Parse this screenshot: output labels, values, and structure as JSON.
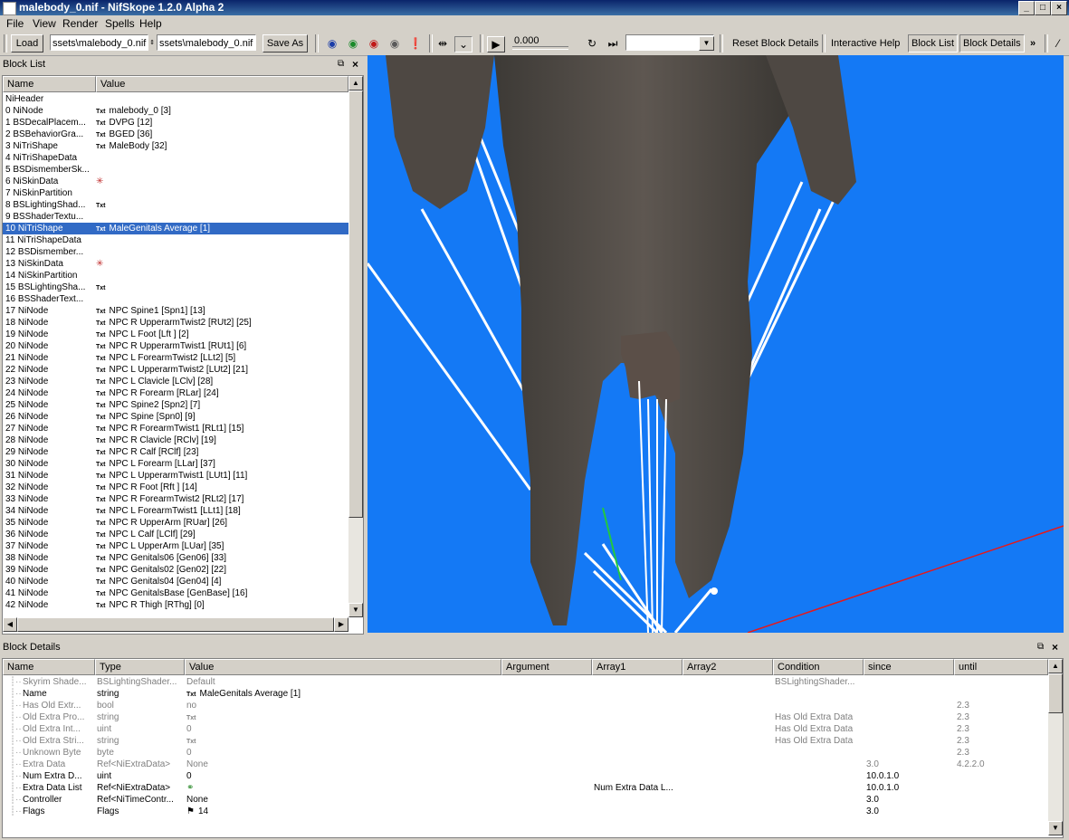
{
  "window": {
    "title": "malebody_0.nif - NifSkope 1.2.0 Alpha 2"
  },
  "menu": [
    "File",
    "View",
    "Render",
    "Spells",
    "Help"
  ],
  "toolbar": {
    "load_label": "Load",
    "load_path": "ssets\\malebody_0.nif",
    "save_path": "ssets\\malebody_0.nif",
    "save_as_label": "Save As",
    "time_value": "0.000",
    "reset_block_details": "Reset Block Details",
    "interactive_help": "Interactive Help",
    "block_list_tab": "Block List",
    "block_details_tab": "Block Details",
    "overflow": "»"
  },
  "block_list": {
    "title": "Block List",
    "columns": [
      "Name",
      "Value"
    ],
    "rows": [
      {
        "name": "NiHeader",
        "value": "",
        "icon": ""
      },
      {
        "name": "0 NiNode",
        "value": "malebody_0 [3]",
        "icon": "txt"
      },
      {
        "name": "1 BSDecalPlacem...",
        "value": "DVPG [12]",
        "icon": "txt"
      },
      {
        "name": "2 BSBehaviorGra...",
        "value": "BGED [36]",
        "icon": "txt"
      },
      {
        "name": "3 NiTriShape",
        "value": "MaleBody [32]",
        "icon": "txt"
      },
      {
        "name": "4 NiTriShapeData",
        "value": "",
        "icon": ""
      },
      {
        "name": "5 BSDismemberSk...",
        "value": "",
        "icon": ""
      },
      {
        "name": "6 NiSkinData",
        "value": "",
        "icon": "axes"
      },
      {
        "name": "7 NiSkinPartition",
        "value": "",
        "icon": ""
      },
      {
        "name": "8 BSLightingShad...",
        "value": "",
        "icon": "txt"
      },
      {
        "name": "9 BSShaderTextu...",
        "value": "",
        "icon": ""
      },
      {
        "name": "10 NiTriShape",
        "value": "MaleGenitals Average [1]",
        "icon": "txt",
        "selected": true
      },
      {
        "name": "11 NiTriShapeData",
        "value": "",
        "icon": ""
      },
      {
        "name": "12 BSDismember...",
        "value": "",
        "icon": ""
      },
      {
        "name": "13 NiSkinData",
        "value": "",
        "icon": "axes"
      },
      {
        "name": "14 NiSkinPartition",
        "value": "",
        "icon": ""
      },
      {
        "name": "15 BSLightingSha...",
        "value": "",
        "icon": "txt"
      },
      {
        "name": "16 BSShaderText...",
        "value": "",
        "icon": ""
      },
      {
        "name": "17 NiNode",
        "value": "NPC Spine1 [Spn1] [13]",
        "icon": "txt"
      },
      {
        "name": "18 NiNode",
        "value": "NPC R UpperarmTwist2 [RUt2] [25]",
        "icon": "txt"
      },
      {
        "name": "19 NiNode",
        "value": "NPC L Foot [Lft ] [2]",
        "icon": "txt"
      },
      {
        "name": "20 NiNode",
        "value": "NPC R UpperarmTwist1 [RUt1] [6]",
        "icon": "txt"
      },
      {
        "name": "21 NiNode",
        "value": "NPC L ForearmTwist2 [LLt2] [5]",
        "icon": "txt"
      },
      {
        "name": "22 NiNode",
        "value": "NPC L UpperarmTwist2 [LUt2] [21]",
        "icon": "txt"
      },
      {
        "name": "23 NiNode",
        "value": "NPC L Clavicle [LClv] [28]",
        "icon": "txt"
      },
      {
        "name": "24 NiNode",
        "value": "NPC R Forearm [RLar] [24]",
        "icon": "txt"
      },
      {
        "name": "25 NiNode",
        "value": "NPC Spine2 [Spn2] [7]",
        "icon": "txt"
      },
      {
        "name": "26 NiNode",
        "value": "NPC Spine [Spn0] [9]",
        "icon": "txt"
      },
      {
        "name": "27 NiNode",
        "value": "NPC R ForearmTwist1 [RLt1] [15]",
        "icon": "txt"
      },
      {
        "name": "28 NiNode",
        "value": "NPC R Clavicle [RClv] [19]",
        "icon": "txt"
      },
      {
        "name": "29 NiNode",
        "value": "NPC R Calf [RClf] [23]",
        "icon": "txt"
      },
      {
        "name": "30 NiNode",
        "value": "NPC L Forearm [LLar] [37]",
        "icon": "txt"
      },
      {
        "name": "31 NiNode",
        "value": "NPC L UpperarmTwist1 [LUt1] [11]",
        "icon": "txt"
      },
      {
        "name": "32 NiNode",
        "value": "NPC R Foot [Rft ] [14]",
        "icon": "txt"
      },
      {
        "name": "33 NiNode",
        "value": "NPC R ForearmTwist2 [RLt2] [17]",
        "icon": "txt"
      },
      {
        "name": "34 NiNode",
        "value": "NPC L ForearmTwist1 [LLt1] [18]",
        "icon": "txt"
      },
      {
        "name": "35 NiNode",
        "value": "NPC R UpperArm [RUar] [26]",
        "icon": "txt"
      },
      {
        "name": "36 NiNode",
        "value": "NPC L Calf [LClf] [29]",
        "icon": "txt"
      },
      {
        "name": "37 NiNode",
        "value": "NPC L UpperArm [LUar] [35]",
        "icon": "txt"
      },
      {
        "name": "38 NiNode",
        "value": "NPC Genitals06 [Gen06] [33]",
        "icon": "txt"
      },
      {
        "name": "39 NiNode",
        "value": "NPC Genitals02 [Gen02] [22]",
        "icon": "txt"
      },
      {
        "name": "40 NiNode",
        "value": "NPC Genitals04 [Gen04] [4]",
        "icon": "txt"
      },
      {
        "name": "41 NiNode",
        "value": "NPC GenitalsBase [GenBase] [16]",
        "icon": "txt"
      },
      {
        "name": "42 NiNode",
        "value": "NPC R Thigh [RThg] [0]",
        "icon": "txt"
      }
    ]
  },
  "block_details": {
    "title": "Block Details",
    "columns": [
      "Name",
      "Type",
      "Value",
      "Argument",
      "Array1",
      "Array2",
      "Condition",
      "since",
      "until"
    ],
    "rows": [
      {
        "name": "Skyrim Shade...",
        "type": "BSLightingShader...",
        "value": "Default",
        "argument": "",
        "array1": "",
        "condition": "BSLightingShader...",
        "since": "",
        "until": "",
        "grey": true
      },
      {
        "name": "Name",
        "type": "string",
        "value": "MaleGenitals Average [1]",
        "icon": "txt",
        "argument": "",
        "array1": "",
        "condition": "",
        "since": "",
        "until": ""
      },
      {
        "name": "Has Old Extr...",
        "type": "bool",
        "value": "no",
        "argument": "",
        "array1": "",
        "condition": "",
        "since": "",
        "until": "2.3",
        "grey": true
      },
      {
        "name": "Old Extra Pro...",
        "type": "string",
        "value": "",
        "icon": "txt",
        "argument": "",
        "array1": "",
        "condition": "Has Old Extra Data",
        "since": "",
        "until": "2.3",
        "grey": true
      },
      {
        "name": "Old Extra Int...",
        "type": "uint",
        "value": "0",
        "argument": "",
        "array1": "",
        "condition": "Has Old Extra Data",
        "since": "",
        "until": "2.3",
        "grey": true
      },
      {
        "name": "Old Extra Stri...",
        "type": "string",
        "value": "",
        "icon": "txt",
        "argument": "",
        "array1": "",
        "condition": "Has Old Extra Data",
        "since": "",
        "until": "2.3",
        "grey": true
      },
      {
        "name": "Unknown Byte",
        "type": "byte",
        "value": "0",
        "argument": "",
        "array1": "",
        "condition": "",
        "since": "",
        "until": "2.3",
        "grey": true
      },
      {
        "name": "Extra Data",
        "type": "Ref<NiExtraData>",
        "value": "None",
        "argument": "",
        "array1": "",
        "condition": "",
        "since": "3.0",
        "until": "4.2.2.0",
        "grey": true
      },
      {
        "name": "Num Extra D...",
        "type": "uint",
        "value": "0",
        "argument": "",
        "array1": "",
        "condition": "",
        "since": "10.0.1.0",
        "until": ""
      },
      {
        "name": "Extra Data List",
        "type": "Ref<NiExtraData>",
        "value": "",
        "icon": "link",
        "argument": "",
        "array1": "Num Extra Data L...",
        "condition": "",
        "since": "10.0.1.0",
        "until": ""
      },
      {
        "name": "Controller",
        "type": "Ref<NiTimeContr...",
        "value": "None",
        "argument": "",
        "array1": "",
        "condition": "",
        "since": "3.0",
        "until": ""
      },
      {
        "name": "Flags",
        "type": "Flags",
        "value": "14",
        "icon": "flag",
        "argument": "",
        "array1": "",
        "condition": "",
        "since": "3.0",
        "until": ""
      }
    ]
  },
  "colors": {
    "viewport_bg": "#1479f5",
    "selection": "#316ac5",
    "title_bar": "#0a246a"
  }
}
